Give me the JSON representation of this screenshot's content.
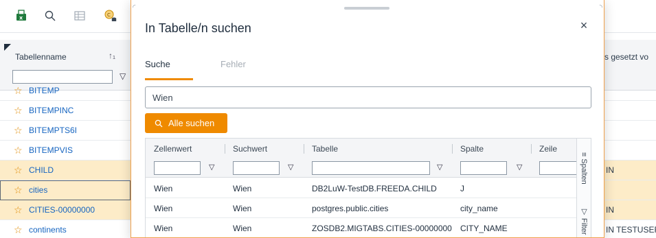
{
  "toolbar": {
    "icons": [
      "excel-export-icon",
      "search-icon",
      "grid-icon",
      "clock-db-icon"
    ]
  },
  "grid": {
    "column_header": "Tabellenname",
    "sort_indicator": "↑₁",
    "right_column_header": "s gesetzt vo",
    "rows": [
      {
        "name": "BITEMP",
        "highlight": false,
        "right": ""
      },
      {
        "name": "BITEMPINC",
        "highlight": false,
        "right": ""
      },
      {
        "name": "BITEMPTS6I",
        "highlight": false,
        "right": ""
      },
      {
        "name": "BITEMPVIS",
        "highlight": false,
        "right": ""
      },
      {
        "name": "CHILD",
        "highlight": true,
        "right": "IN"
      },
      {
        "name": "cities",
        "highlight": true,
        "right": ""
      },
      {
        "name": "CITIES-00000000",
        "highlight": true,
        "right": "IN"
      },
      {
        "name": "continents",
        "highlight": false,
        "right": "IN TESTUSER"
      }
    ]
  },
  "modal": {
    "title": "In Tabelle/n suchen",
    "close": "×",
    "tabs": [
      {
        "label": "Suche",
        "active": true
      },
      {
        "label": "Fehler",
        "active": false
      }
    ],
    "search_value": "Wien",
    "search_button": "Alle suchen",
    "results": {
      "columns": [
        "Zellenwert",
        "Suchwert",
        "Tabelle",
        "Spalte",
        "Zeile"
      ],
      "rows": [
        [
          "Wien",
          "Wien",
          "DB2LuW-TestDB.FREEDA.CHILD",
          "J",
          ""
        ],
        [
          "Wien",
          "Wien",
          "postgres.public.cities",
          "city_name",
          ""
        ],
        [
          "Wien",
          "Wien",
          "ZOSDB2.MIGTABS.CITIES-00000000",
          "CITY_NAME",
          ""
        ]
      ]
    },
    "side_panel": {
      "columns_label": "Spalten",
      "filter_label": "Filter"
    }
  },
  "colors": {
    "accent": "#ef8a00",
    "row_highlight": "#fdecc8",
    "link": "#1564c0"
  }
}
